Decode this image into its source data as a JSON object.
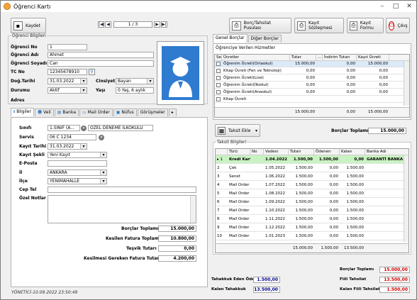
{
  "window": {
    "title": "Öğrenci Kartı"
  },
  "toolbar": {
    "save_label": "Kaydet",
    "page_indicator": "1 / 3",
    "debt_slip_label": "Borç/Tahsilat Pusulası",
    "contract_label": "Kayıt Sözleşmesi",
    "form_label": "Kayıt Formu",
    "exit_label": "Çıkış"
  },
  "student": {
    "group_label": "Öğrenci Bilgileri",
    "no_label": "Öğrenci No",
    "no": "1",
    "name_label": "Öğrenci Adı",
    "name": "Ahmet",
    "surname_label": "Öğrenci Soyadı",
    "surname": "Can",
    "tc_label": "TC No",
    "tc": "12345678910",
    "birth_label": "Doğ.Tarihi",
    "birth": "31.03.2022",
    "gender_label": "Cinsiyet",
    "gender": "Bayan",
    "status_label": "Durumu",
    "status": "Aktif",
    "age_label": "Yaşı",
    "age": "0 Yaş,  6 aylık",
    "address_label": "Adres"
  },
  "tabs": [
    "Bilgiler",
    "Veli",
    "Banka",
    "Mail Order",
    "Nüfus",
    "Görüşmeler"
  ],
  "info": {
    "class_label": "Sınıfı",
    "class": "1.SINIF (A...",
    "school": "ÖZEL DENEME İLKOKULU",
    "bus_label": "Servis",
    "bus": "06 C 1234",
    "reg_date_label": "Kayıt Tarihi",
    "reg_date": "31.03.2022",
    "reg_type_label": "Kayıt Şekli",
    "reg_type": "Yeni Kayıt",
    "email_label": "E-Posta",
    "email": "",
    "city_label": "İl",
    "city": "ANKARA",
    "district_label": "İlçe",
    "district": "YENİMAHALLE",
    "phone_label": "Cep Tel",
    "phone": "",
    "notes_label": "Özel Notlar",
    "notes": ""
  },
  "left_totals": {
    "debt_label": "Borçlar Toplamı",
    "debt": "15.000,00",
    "invoice_label": "Kesilen Fatura Toplamı",
    "invoice": "10.800,00",
    "tesvik_label": "Teşvik Tutarı",
    "tesvik": "0,00",
    "need_label": "Kesilmesi Gereken Fatura Tutarı",
    "need": "4.200,00"
  },
  "footer": {
    "status": "YÖNETİCİ-10.09.2022 23:50:49"
  },
  "right_tabs": [
    "Genel Borçlar",
    "Diğer Borçlar"
  ],
  "fees": {
    "group_label": "Öğrenciye Verilen Hizmetler",
    "headers": [
      "Seç",
      "Ücretler",
      "Tutar",
      "İndirim Tutarı",
      "Kayıt Ücreti"
    ],
    "rows": [
      {
        "name": "Öğrenim Ücreti(Ortaokul)",
        "tutar": "15.000,00",
        "indirim": "0,00",
        "kayit": "15.000,00"
      },
      {
        "name": "Kitap Ücreti (Fen ve Teknoloji)",
        "tutar": "0,00",
        "indirim": "0,00",
        "kayit": "0,00"
      },
      {
        "name": "Öğrenim Ücreti(Lise)",
        "tutar": "0,00",
        "indirim": "0,00",
        "kayit": "0,00"
      },
      {
        "name": "Öğrenim Ücreti(İlkokul)",
        "tutar": "0,00",
        "indirim": "0,00",
        "kayit": "0,00"
      },
      {
        "name": "Öğrenim Ücreti(Anaokul)",
        "tutar": "0,00",
        "indirim": "0,00",
        "kayit": "0,00"
      },
      {
        "name": "Kitap Ücreti",
        "tutar": "",
        "indirim": "",
        "kayit": ""
      }
    ],
    "total_tutar": "15.000,00",
    "total_indirim": "0,00",
    "total_kayit": "15.000,00"
  },
  "installment": {
    "add_label": "Taksit Ekle",
    "debt_total_label": "Borçlar Toplamı",
    "debt_total": "15.000,00",
    "group_label": "Taksit Bilgileri",
    "headers": [
      "Türü",
      "No",
      "Vadesi",
      "Tutarı",
      "Ödenen",
      "Kalan",
      "Banka Adı"
    ],
    "rows": [
      {
        "no": "1",
        "type": "Kredi Kartı",
        "due": "1.04.2022",
        "amount": "1.500,00",
        "paid": "1.500,00",
        "rest": "0,00",
        "bank": "GARANTİ BANKA"
      },
      {
        "no": "2",
        "type": "Çek",
        "due": "1.05.2022",
        "amount": "1.500,00",
        "paid": "0,00",
        "rest": "1.500,00",
        "bank": ""
      },
      {
        "no": "3",
        "type": "Senet",
        "due": "1.06.2022",
        "amount": "1.500,00",
        "paid": "0,00",
        "rest": "1.500,00",
        "bank": ""
      },
      {
        "no": "4",
        "type": "Mail Order",
        "due": "1.07.2022",
        "amount": "1.500,00",
        "paid": "0,00",
        "rest": "1.500,00",
        "bank": ""
      },
      {
        "no": "5",
        "type": "Mail Order",
        "due": "1.08.2022",
        "amount": "1.500,00",
        "paid": "0,00",
        "rest": "1.500,00",
        "bank": ""
      },
      {
        "no": "6",
        "type": "Mail Order",
        "due": "1.09.2022",
        "amount": "1.500,00",
        "paid": "0,00",
        "rest": "1.500,00",
        "bank": ""
      },
      {
        "no": "7",
        "type": "Mail Order",
        "due": "1.10.2022",
        "amount": "1.500,00",
        "paid": "0,00",
        "rest": "1.500,00",
        "bank": ""
      },
      {
        "no": "8",
        "type": "Mail Order",
        "due": "1.11.2022",
        "amount": "1.500,00",
        "paid": "0,00",
        "rest": "1.500,00",
        "bank": ""
      },
      {
        "no": "9",
        "type": "Mail Order",
        "due": "1.12.2022",
        "amount": "1.500,00",
        "paid": "0,00",
        "rest": "1.500,00",
        "bank": ""
      },
      {
        "no": "10",
        "type": "Mail Order",
        "due": "1.01.2023",
        "amount": "1.500,00",
        "paid": "0,00",
        "rest": "1.500,00",
        "bank": ""
      }
    ],
    "total_amount": "15.000,00",
    "total_paid": "1.500,00",
    "total_rest": "13.500,00"
  },
  "bottom": {
    "due_paid_label": "Tahakkuk Eden Ödeme",
    "due_paid": "1.500,00",
    "remaining_due_label": "Kalan Tahakkuk",
    "remaining_due": "13.500,00",
    "debt_total_label": "Borçlar Toplamı",
    "debt_total": "15.000,00",
    "actual_paid_label": "Fiili Tahsilat",
    "actual_paid": "13.500,00",
    "actual_remaining_label": "Kalan Fiili Tahsilat",
    "actual_remaining": "1.500,00"
  },
  "colors": {
    "selected_row": "#c9f2c2",
    "red_value": "#d40000",
    "blue_value": "#00008b",
    "accent": "#1f6fbf"
  }
}
